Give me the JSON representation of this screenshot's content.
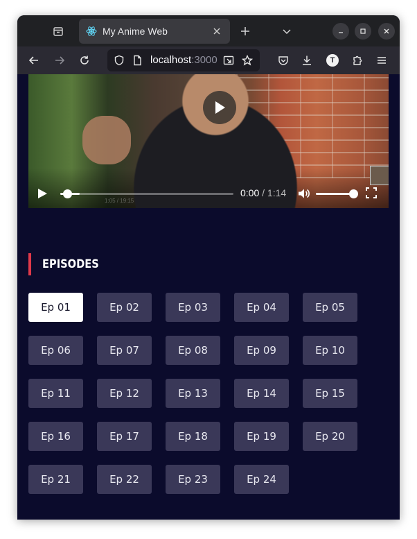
{
  "browser": {
    "tab_title": "My Anime Web",
    "url_host": "localhost",
    "url_port": ":3000",
    "profile_initial": "T"
  },
  "player": {
    "current_time": "0:00",
    "separator": " / ",
    "duration": "1:14",
    "progress_fraction": 0.0,
    "volume_fraction": 1.0,
    "burnin_time": "1:05 / 19:15"
  },
  "episodes_section": {
    "title": "EPISODES",
    "active_index": 0,
    "items": [
      "Ep 01",
      "Ep 02",
      "Ep 03",
      "Ep 04",
      "Ep 05",
      "Ep 06",
      "Ep 07",
      "Ep 08",
      "Ep 09",
      "Ep 10",
      "Ep 11",
      "Ep 12",
      "Ep 13",
      "Ep 14",
      "Ep 15",
      "Ep 16",
      "Ep 17",
      "Ep 18",
      "Ep 19",
      "Ep 20",
      "Ep 21",
      "Ep 22",
      "Ep 23",
      "Ep 24"
    ]
  },
  "colors": {
    "page_bg": "#0b0b2c",
    "episode_btn": "#3a3858",
    "episode_active": "#ffffff",
    "accent_bar": "#e0394a"
  }
}
